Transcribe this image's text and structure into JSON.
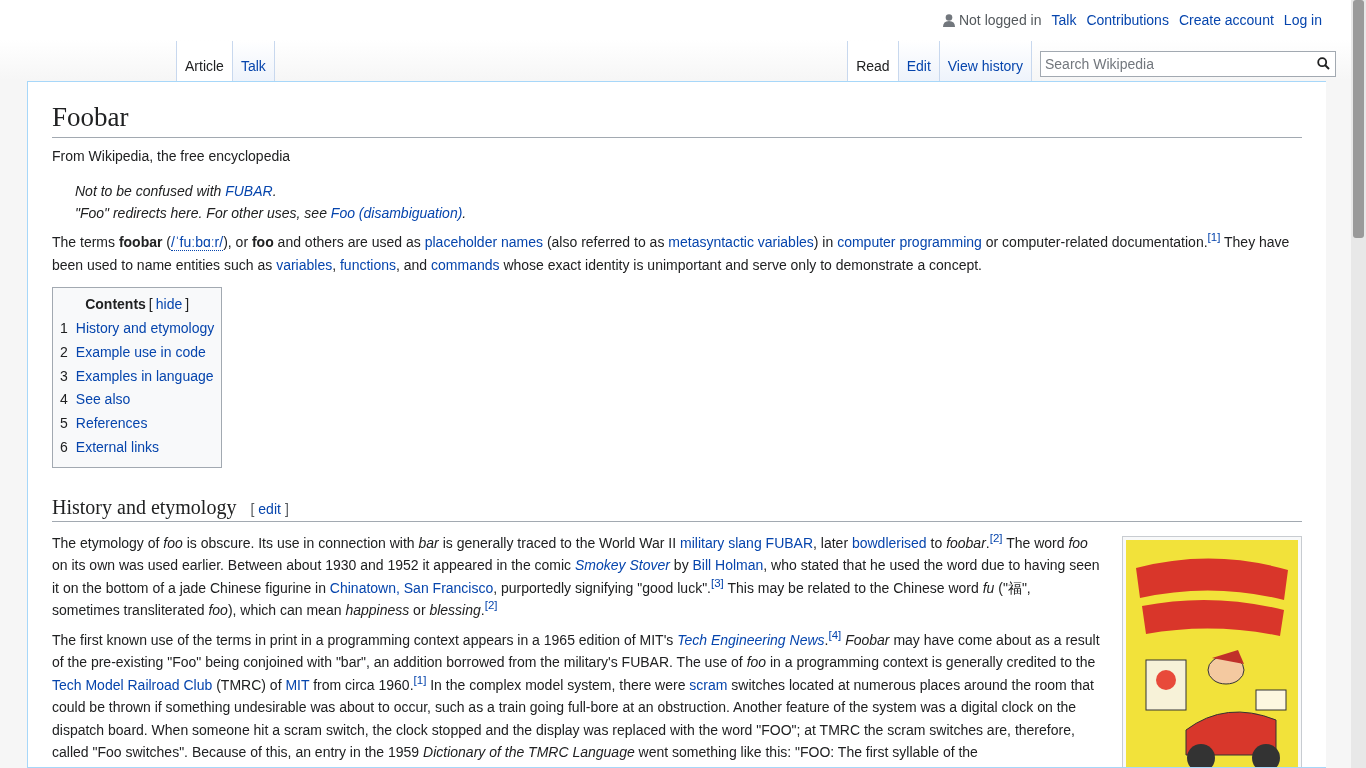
{
  "personal_tools": {
    "status": "Not logged in",
    "links": [
      "Talk",
      "Contributions",
      "Create account",
      "Log in"
    ]
  },
  "namespace_tabs": [
    {
      "label": "Article",
      "selected": true
    },
    {
      "label": "Talk",
      "selected": false
    }
  ],
  "view_tabs": [
    {
      "label": "Read",
      "selected": true
    },
    {
      "label": "Edit",
      "selected": false
    },
    {
      "label": "View history",
      "selected": false
    }
  ],
  "search": {
    "placeholder": "Search Wikipedia"
  },
  "article": {
    "title": "Foobar",
    "tagline": "From Wikipedia, the free encyclopedia",
    "hatnotes": [
      [
        {
          "kind": "text",
          "text": "Not to be confused with "
        },
        {
          "kind": "link",
          "text": "FUBAR"
        },
        {
          "kind": "text",
          "text": "."
        }
      ],
      [
        {
          "kind": "text",
          "text": "\"Foo\" redirects here. For other uses, see "
        },
        {
          "kind": "link",
          "text": "Foo (disambiguation)"
        },
        {
          "kind": "text",
          "text": "."
        }
      ]
    ],
    "intro": [
      [
        {
          "kind": "text",
          "text": "The terms **foobar** ("
        },
        {
          "kind": "ipa",
          "text": "/ˈfuːbɑːr/"
        },
        {
          "kind": "text",
          "text": "), or **foo** and others are used as "
        },
        {
          "kind": "link",
          "text": "placeholder names"
        },
        {
          "kind": "text",
          "text": " (also referred to as "
        },
        {
          "kind": "link",
          "text": "metasyntactic variables"
        },
        {
          "kind": "text",
          "text": ") in "
        },
        {
          "kind": "link",
          "text": "computer programming"
        },
        {
          "kind": "text",
          "text": " or computer-related documentation."
        },
        {
          "kind": "ref",
          "text": "[1]"
        },
        {
          "kind": "text",
          "text": " They have been used to name entities such as "
        },
        {
          "kind": "link",
          "text": "variables"
        },
        {
          "kind": "text",
          "text": ", "
        },
        {
          "kind": "link",
          "text": "functions"
        },
        {
          "kind": "text",
          "text": ", and "
        },
        {
          "kind": "link",
          "text": "commands"
        },
        {
          "kind": "text",
          "text": " whose exact identity is unimportant and serve only to demonstrate a concept."
        }
      ]
    ],
    "toc": {
      "title": "Contents",
      "toggle_open": "[",
      "toggle": "hide",
      "toggle_close": "]",
      "items": [
        {
          "number": "1",
          "label": "History and etymology"
        },
        {
          "number": "2",
          "label": "Example use in code"
        },
        {
          "number": "3",
          "label": "Examples in language"
        },
        {
          "number": "4",
          "label": "See also"
        },
        {
          "number": "5",
          "label": "References"
        },
        {
          "number": "6",
          "label": "External links"
        }
      ]
    },
    "sections": [
      {
        "heading": "History and etymology",
        "edit_open": "[",
        "edit": "edit",
        "edit_close": "]",
        "figure": {
          "kind": "picture"
        },
        "paragraphs": [
          [
            {
              "kind": "text",
              "text": "The etymology of *foo* is obscure. Its use in connection with *bar* is generally traced to the World War II "
            },
            {
              "kind": "link",
              "text": "military slang FUBAR"
            },
            {
              "kind": "text",
              "text": ", later "
            },
            {
              "kind": "link",
              "text": "bowdlerised"
            },
            {
              "kind": "text",
              "text": " to *foobar*."
            },
            {
              "kind": "ref",
              "text": "[2]"
            },
            {
              "kind": "text",
              "text": " The word *foo* on its own was used earlier. Between about 1930 and 1952 it appeared in the comic "
            },
            {
              "kind": "link",
              "text": "Smokey Stover",
              "italic": true
            },
            {
              "kind": "text",
              "text": " by "
            },
            {
              "kind": "link",
              "text": "Bill Holman"
            },
            {
              "kind": "text",
              "text": ", who stated that he used the word due to having seen it on the bottom of a jade Chinese figurine in "
            },
            {
              "kind": "link",
              "text": "Chinatown, San Francisco"
            },
            {
              "kind": "text",
              "text": ", purportedly signifying \"good luck\"."
            },
            {
              "kind": "ref",
              "text": "[3]"
            },
            {
              "kind": "text",
              "text": " This may be related to the Chinese word *fu* (\"福\", sometimes transliterated *foo*), which can mean *happiness* or *blessing*."
            },
            {
              "kind": "ref",
              "text": "[2]"
            }
          ],
          [
            {
              "kind": "text",
              "text": "The first known use of the terms in print in a programming context appears in a 1965 edition of MIT's "
            },
            {
              "kind": "link",
              "text": "Tech Engineering News",
              "italic": true
            },
            {
              "kind": "text",
              "text": "."
            },
            {
              "kind": "ref",
              "text": "[4]"
            },
            {
              "kind": "text",
              "text": " *Foobar* may have come about as a result of the pre-existing \"Foo\" being conjoined with \"bar\", an addition borrowed from the military's FUBAR. The use of *foo* in a programming context is generally credited to the "
            },
            {
              "kind": "link",
              "text": "Tech Model Railroad Club"
            },
            {
              "kind": "text",
              "text": " (TMRC) of "
            },
            {
              "kind": "link",
              "text": "MIT"
            },
            {
              "kind": "text",
              "text": " from circa 1960."
            },
            {
              "kind": "ref",
              "text": "[1]"
            },
            {
              "kind": "text",
              "text": " In the complex model system, there were "
            },
            {
              "kind": "link",
              "text": "scram"
            },
            {
              "kind": "text",
              "text": " switches located at numerous places around the room that could be thrown if something undesirable was about to occur, such as a train going full-bore at an obstruction. Another feature of the system was a digital clock on the dispatch board. When someone hit a scram switch, the clock stopped and the display was replaced with the word \"FOO\"; at TMRC the scram switches are, therefore, called \"Foo switches\". Because of this, an entry in the 1959 *Dictionary of the TMRC Language* went something like this: \"FOO: The first syllable of the"
            }
          ]
        ]
      }
    ]
  }
}
